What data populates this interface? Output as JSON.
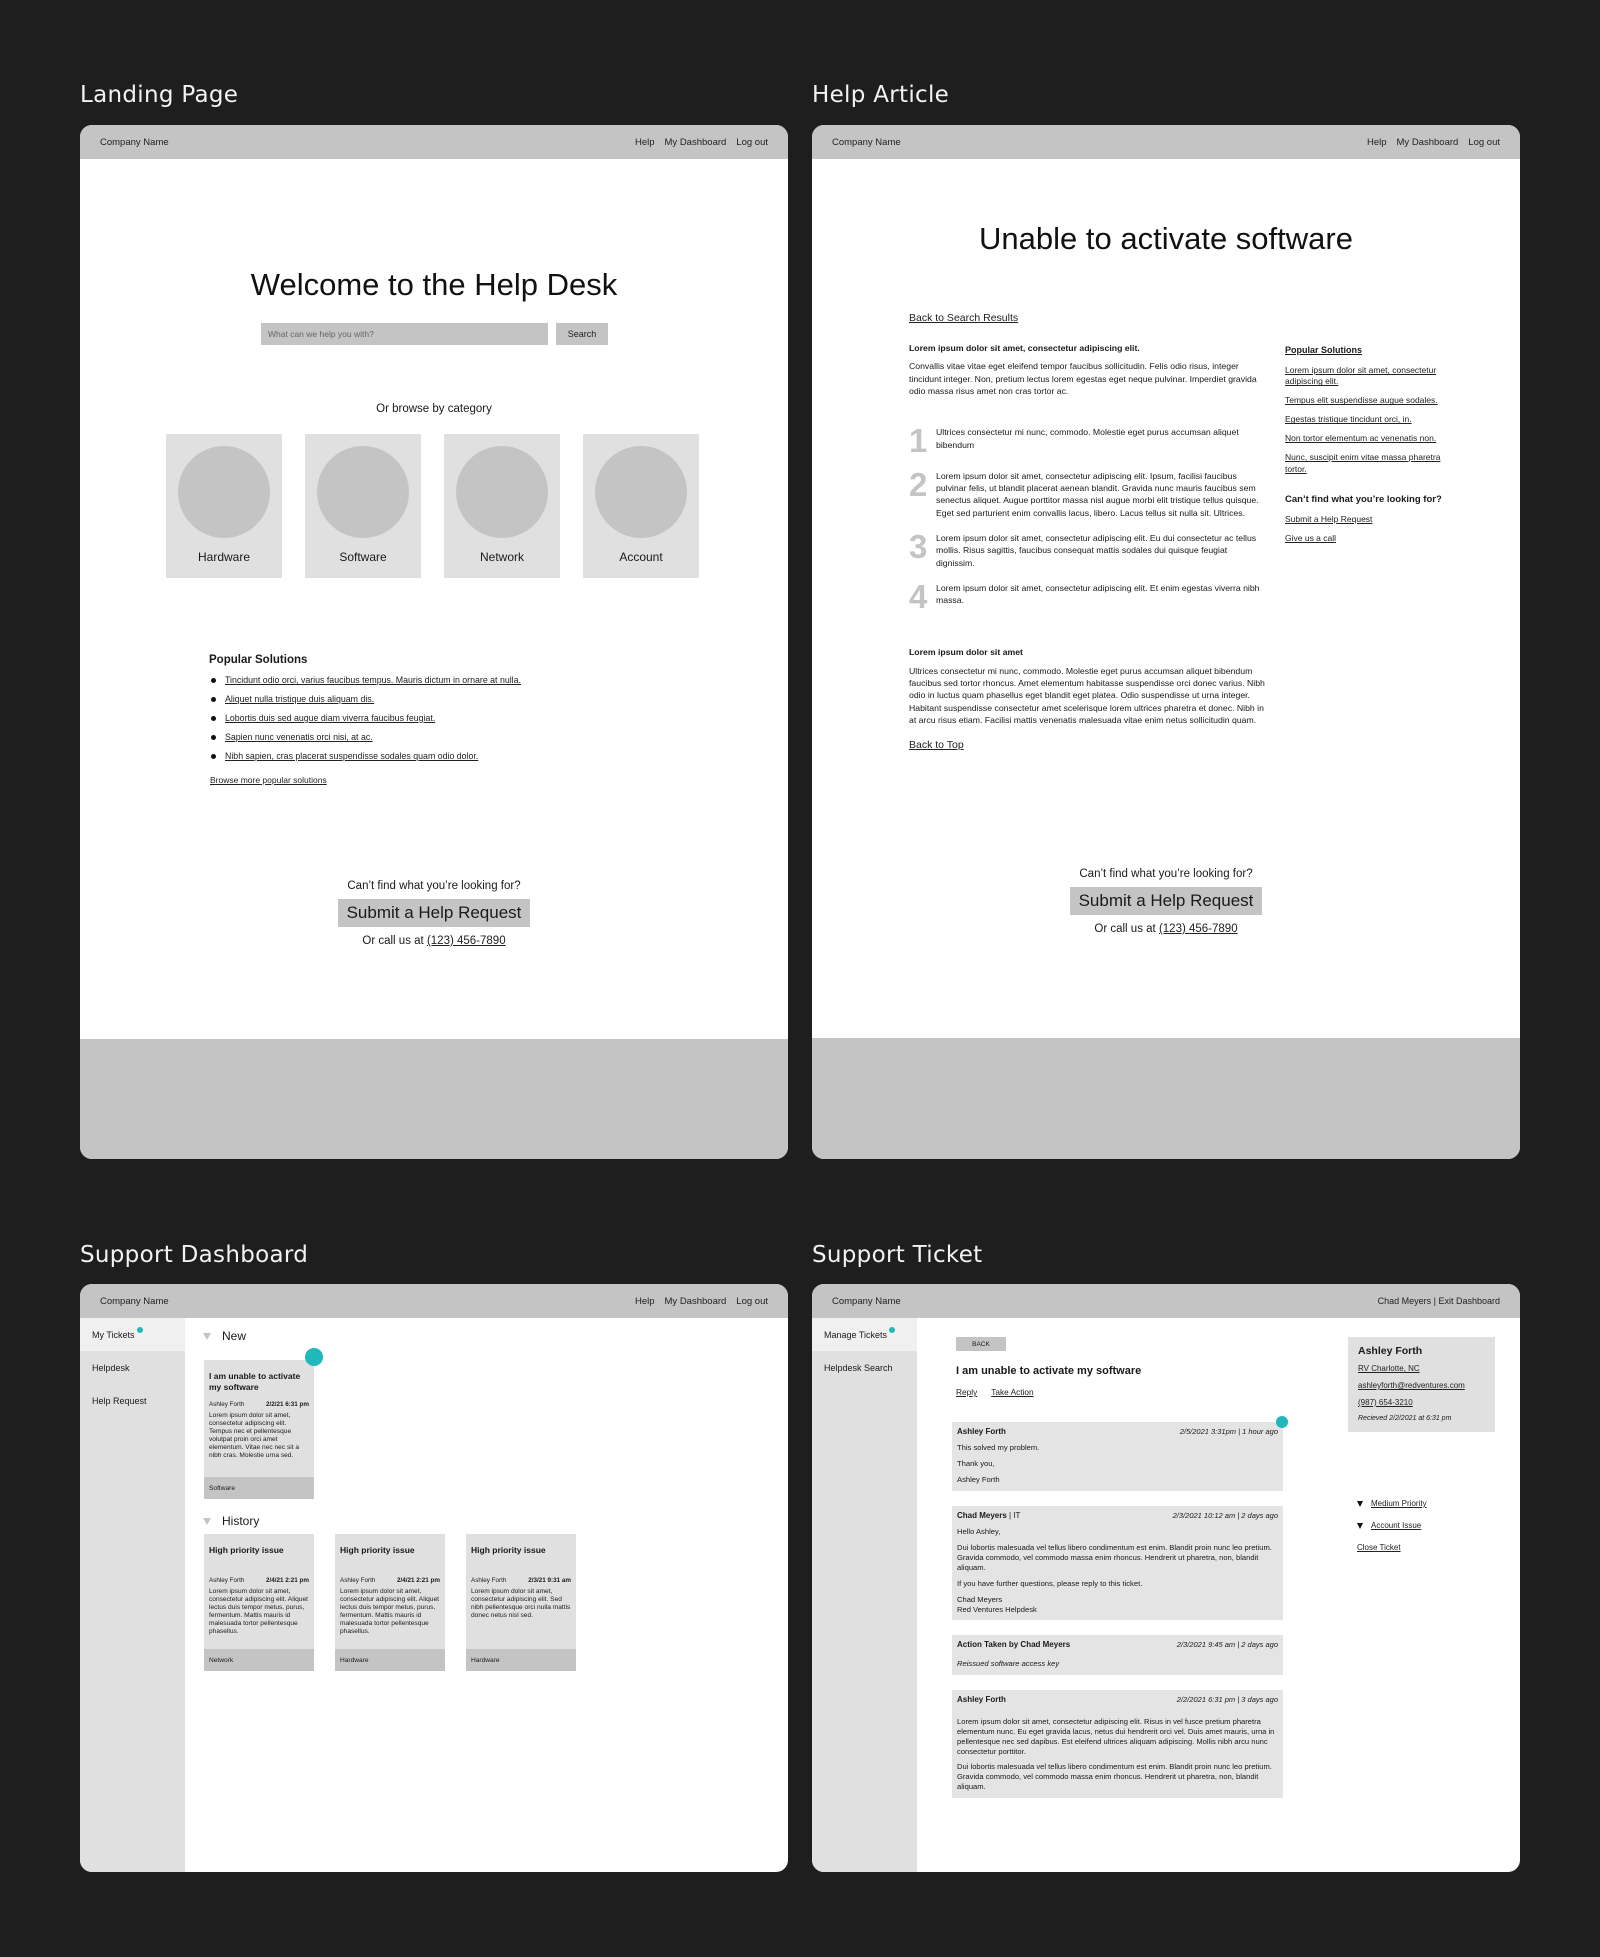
{
  "panels": {
    "landing": "Landing Page",
    "article": "Help Article",
    "dashboard": "Support Dashboard",
    "ticket": "Support Ticket"
  },
  "topbar": {
    "company": "Company Name",
    "nav": [
      "Help",
      "My Dashboard",
      "Log out"
    ],
    "agent_user": "Chad Meyers | Exit Dashboard"
  },
  "landing": {
    "title": "Welcome to the Help Desk",
    "search_placeholder": "What can we help you with?",
    "search_button": "Search",
    "browse_label": "Or browse by category",
    "categories": [
      "Hardware",
      "Software",
      "Network",
      "Account"
    ],
    "popular_heading": "Popular Solutions",
    "popular_items": [
      "Tincidunt odio orci, varius faucibus tempus. Mauris dictum in ornare at nulla.",
      "Aliquet nulla tristique duis aliquam dis.",
      "Lobortis duis sed augue diam viverra faucibus feugiat.",
      "Sapien nunc venenatis orci nisi, at ac.",
      "Nibh sapien, cras placerat suspendisse sodales quam odio dolor."
    ],
    "browse_more": "Browse more popular solutions"
  },
  "cta": {
    "question": "Can’t find what you’re looking for?",
    "button": "Submit a Help Request",
    "call_prefix": "Or call us at ",
    "phone": "(123) 456-7890"
  },
  "article": {
    "title": "Unable to activate software",
    "back_to_results": "Back to Search Results",
    "lead_heading": "Lorem ipsum dolor sit amet, consectetur adipiscing elit.",
    "lead_text": "Convallis vitae vitae eget eleifend tempor faucibus sollicitudin. Felis odio risus, integer tincidunt integer. Non, pretium lectus lorem egestas eget neque pulvinar. Imperdiet gravida odio massa risus amet non cras tortor ac.",
    "steps": [
      {
        "num": "1",
        "text": "Ultrices consectetur mi nunc, commodo. Molestie eget purus accumsan aliquet bibendum"
      },
      {
        "num": "2",
        "text": "Lorem ipsum dolor sit amet, consectetur adipiscing elit. Ipsum, facilisi faucibus pulvinar felis, ut blandit placerat aenean blandit. Gravida nunc mauris faucibus sem senectus aliquet. Augue porttitor massa nisl augue morbi elit tristique tellus quisque. Eget sed parturient enim convallis lacus, libero. Lacus tellus sit nulla sit. Ultrices."
      },
      {
        "num": "3",
        "text": "Lorem ipsum dolor sit amet, consectetur adipiscing elit. Eu dui consectetur ac tellus mollis. Risus sagittis, faucibus consequat mattis sodales dui quisque feugiat dignissim."
      },
      {
        "num": "4",
        "text": "Lorem ipsum dolor sit amet, consectetur adipiscing elit. Et enim egestas viverra nibh massa."
      }
    ],
    "section_heading": "Lorem ipsum dolor sit amet",
    "section_text": "Ultrices consectetur mi nunc, commodo. Molestie eget purus accumsan aliquet bibendum faucibus sed tortor rhoncus. Amet elementum habitasse suspendisse orci donec varius. Nibh odio in luctus quam phasellus eget blandit eget platea. Odio suspendisse ut urna integer. Habitant suspendisse consectetur amet scelerisque lorem ultrices pharetra et donec. Nibh in at arcu risus etiam. Facilisi mattis venenatis malesuada vitae enim netus sollicitudin quam.",
    "back_to_top": "Back to Top",
    "aside": {
      "heading": "Popular Solutions",
      "links": [
        "Lorem ipsum dolor sit amet, consectetur adipiscing elit.",
        "Tempus elit suspendisse augue sodales.",
        "Egestas tristique tincidunt orci, in.",
        "Non tortor elementum ac venenatis non.",
        "Nunc, suscipit enim vitae massa pharetra tortor."
      ],
      "help_heading": "Can’t find what you’re looking for?",
      "help_links": [
        "Submit a Help Request",
        "Give us a call"
      ]
    }
  },
  "dashboard": {
    "sidebar": [
      "My Tickets",
      "Helpdesk",
      "Help Request"
    ],
    "new_label": "New",
    "history_label": "History",
    "new_ticket": {
      "title": "I am unable to activate my software",
      "author": "Ashley Forth",
      "date": "2/2/21 6:31 pm",
      "text": "Lorem ipsum dolor sit amet, consectetur adipiscing elit. Tempus nec et pellentesque volutpat proin orci amet elementum. Vitae nec nec sit a nibh cras. Molestie urna sed.",
      "category": "Software"
    },
    "history": [
      {
        "title": "High priority issue",
        "author": "Ashley Forth",
        "date": "2/4/21 2:21 pm",
        "text": "Lorem ipsum dolor sit amet, consectetur adipiscing elit. Aliquet lectus duis tempor metus, purus, fermentum. Mattis mauris id malesuada tortor pellentesque phasellus.",
        "category": "Network"
      },
      {
        "title": "High priority issue",
        "author": "Ashley Forth",
        "date": "2/4/21 2:21 pm",
        "text": "Lorem ipsum dolor sit amet, consectetur adipiscing elit. Aliquet lectus duis tempor metus, purus, fermentum. Mattis mauris id malesuada tortor pellentesque phasellus.",
        "category": "Hardware"
      },
      {
        "title": "High priority issue",
        "author": "Ashley Forth",
        "date": "2/3/21 9:31 am",
        "text": "Lorem ipsum dolor sit amet, consectetur adipiscing elit. Sed nibh pellentesque orci nulla mattis donec netus nisl sed.",
        "category": "Hardware"
      }
    ]
  },
  "ticket": {
    "sidebar": [
      "Manage Tickets",
      "Helpdesk Search"
    ],
    "back": "BACK",
    "title": "I am unable to activate my software",
    "actions": [
      "Reply",
      "Take Action"
    ],
    "messages": [
      {
        "author": "Ashley Forth",
        "role": "",
        "when": "2/5/2021 3:31pm | 1 hour ago",
        "paragraphs": [
          "This solved my problem.",
          "Thank you,",
          "Ashley Forth"
        ],
        "italic": false
      },
      {
        "author": "Chad Meyers",
        "role": " | IT",
        "when": "2/3/2021 10:12 am | 2 days ago",
        "paragraphs": [
          "Hello Ashley,",
          "Dui lobortis malesuada vel tellus libero condimentum est enim. Blandit proin nunc leo pretium. Gravida commodo, vel commodo massa enim rhoncus. Hendrerit ut pharetra, non, blandit aliquam.",
          "If you have further questions, please reply to this ticket.",
          "Chad Meyers\nRed Ventures Helpdesk"
        ],
        "italic": false
      },
      {
        "author": "Action Taken by Chad Meyers",
        "role": "",
        "when": "2/3/2021 9:45 am | 2 days ago",
        "paragraphs": [
          "Reissued software access key"
        ],
        "italic": true
      },
      {
        "author": "Ashley Forth",
        "role": "",
        "when": "2/2/2021 6:31 pm | 3 days ago",
        "paragraphs": [
          "Lorem ipsum dolor sit amet, consectetur adipiscing elit. Risus in vel fusce pretium pharetra elementum nunc. Eu eget gravida lacus, netus dui hendrerit orci vel. Duis amet mauris, urna in pellentesque nec sed dapibus. Est eleifend ultrices aliquam adipiscing. Mollis nibh arcu nunc consectetur porttitor.",
          "Dui lobortis malesuada vel tellus libero condimentum est enim. Blandit proin nunc leo pretium. Gravida commodo, vel commodo massa enim rhoncus. Hendrerit ut pharetra, non, blandit aliquam."
        ],
        "italic": false
      }
    ],
    "contact": {
      "name": "Ashley Forth",
      "location": "RV Charlotte, NC",
      "email": "ashleyforth@redventures.com",
      "phone": "(987) 654-3210",
      "received": "Recieved 2/2/2021 at 6:31 pm"
    },
    "priority": "Medium Priority",
    "issue_type": "Account Issue",
    "close": "Close Ticket"
  },
  "colors": {
    "accent": "#21b8bc",
    "placeholder_gray": "#c4c4c4",
    "card_gray": "#e0e0e0",
    "background": "#1e1e1e"
  }
}
